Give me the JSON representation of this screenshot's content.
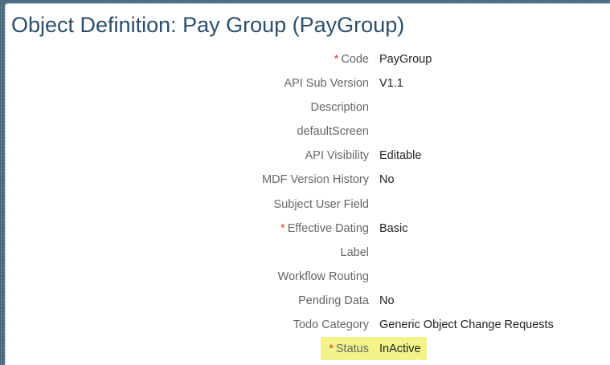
{
  "header": {
    "title": "Object Definition: Pay Group (PayGroup)"
  },
  "fields": [
    {
      "label": "Code",
      "value": "PayGroup",
      "required": true,
      "required_marker": "*"
    },
    {
      "label": "API Sub Version",
      "value": "V1.1",
      "required": false
    },
    {
      "label": "Description",
      "value": "",
      "required": false
    },
    {
      "label": "defaultScreen",
      "value": "",
      "required": false
    },
    {
      "label": "API Visibility",
      "value": "Editable",
      "required": false
    },
    {
      "label": "MDF Version History",
      "value": "No",
      "required": false
    },
    {
      "label": "Subject User Field",
      "value": "",
      "required": false
    },
    {
      "label": "Effective Dating",
      "value": "Basic",
      "required": true,
      "required_marker": "*"
    },
    {
      "label": "Label",
      "value": "",
      "required": false
    },
    {
      "label": "Workflow Routing",
      "value": "",
      "required": false
    },
    {
      "label": "Pending Data",
      "value": "No",
      "required": false
    },
    {
      "label": "Todo Category",
      "value": "Generic Object Change Requests",
      "required": false
    },
    {
      "label": "Status",
      "value": "InActive",
      "required": true,
      "required_marker": "*",
      "highlighted": true
    }
  ],
  "colors": {
    "background": "#4e6e86",
    "title": "#2a4e6c",
    "label": "#666666",
    "value": "#222222",
    "required_marker": "#e0402a",
    "highlight": "#f3f38a"
  }
}
